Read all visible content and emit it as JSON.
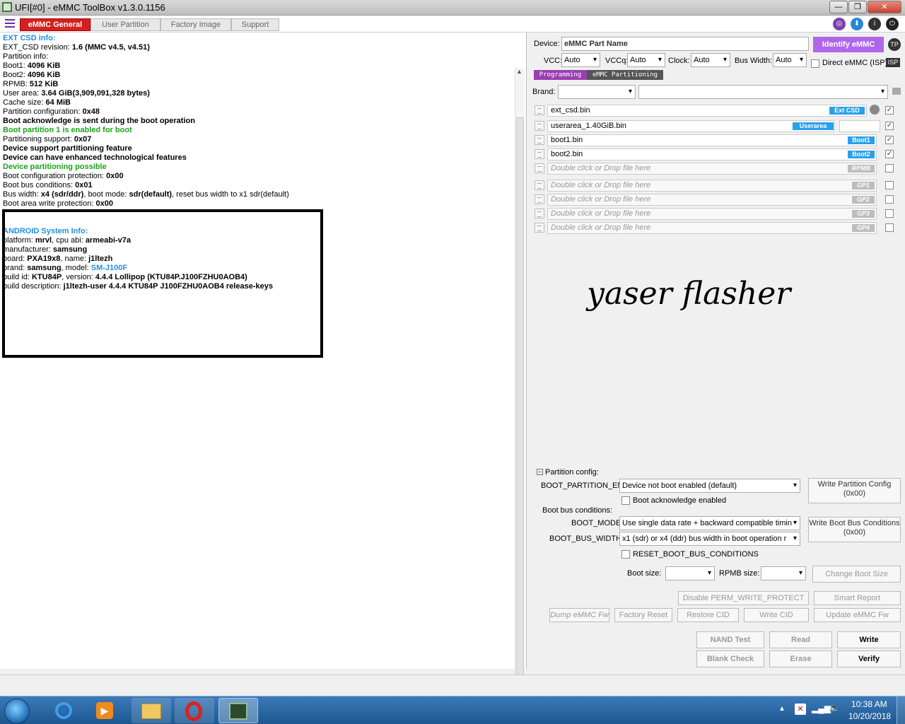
{
  "window": {
    "title": "UFI[#0] - eMMC ToolBox v1.3.0.1156"
  },
  "tabs": [
    "eMMC General",
    "User Partition",
    "Factory Image",
    "Support"
  ],
  "top_icons": [
    "purple-chip-icon",
    "download-icon",
    "info-icon",
    "power-icon"
  ],
  "log": [
    {
      "t": "EXT CSD info:",
      "c": "blue"
    },
    {
      "t": "EXT_CSD revision: ",
      "v": "1.6 (MMC v4.5, v4.51)"
    },
    {
      "t": "Partition info:"
    },
    {
      "t": " Boot1: ",
      "v": "4096 KiB"
    },
    {
      "t": " Boot2: ",
      "v": "4096 KiB"
    },
    {
      "t": " RPMB: ",
      "v": "512 KiB"
    },
    {
      "t": " User area: ",
      "v": "3.64 GiB(3,909,091,328 bytes)"
    },
    {
      "t": "Cache size: ",
      "v": "64 MiB"
    },
    {
      "t": "Partition configuration: ",
      "v": "0x48"
    },
    {
      "t": " Boot acknowledge is sent during the boot operation",
      "c": "b"
    },
    {
      "t": " Boot partition 1 is enabled for boot",
      "c": "green"
    },
    {
      "t": "Partitioning support: ",
      "v": "0x07"
    },
    {
      "t": " Device support partitioning feature",
      "c": "b"
    },
    {
      "t": " Device can have enhanced technological features",
      "c": "b"
    },
    {
      "t": " Device partitioning possible",
      "c": "green"
    },
    {
      "t": "Boot configuration protection: ",
      "v": "0x00"
    },
    {
      "t": "Boot bus conditions: ",
      "v": "0x01"
    },
    {
      "t": " Bus width: ",
      "v": "x4 (sdr/ddr)",
      "t2": ", boot mode: ",
      "v2": "sdr(default)",
      "t3": ", reset bus width to x1 sdr(default)"
    },
    {
      "t": "Boot area write protection: ",
      "v": "0x00"
    }
  ],
  "android": [
    {
      "t": "ANDROID System Info:",
      "c": "blue"
    },
    {
      "t": "platform: ",
      "v": "mrvl",
      "t2": ", cpu abi: ",
      "v2": "armeabi-v7a"
    },
    {
      "t": "manufacturer: ",
      "v": "samsung"
    },
    {
      "t": "board: ",
      "v": "PXA19x8",
      "t2": ", name: ",
      "v2": "j1ltezh"
    },
    {
      "t": "brand: ",
      "v": "samsung",
      "t2": ", model: ",
      "v3": "SM-J100F"
    },
    {
      "t": "build id: ",
      "v": "KTU84P",
      "t2": ", version: ",
      "v2": "4.4.4 Lollipop (KTU84P.J100FZHU0AOB4)"
    },
    {
      "t": "build description: ",
      "v": "j1ltezh-user 4.4.4 KTU84P J100FZHU0AOB4 release-keys"
    }
  ],
  "device": {
    "label": "Device:",
    "part_name": "eMMC Part Name",
    "identify_btn": "Identify eMMC",
    "tp": "TP",
    "vcc_label": "VCC:",
    "vcc": "Auto",
    "vccq_label": "VCCq:",
    "vccq": "Auto",
    "clock_label": "Clock:",
    "clock": "Auto",
    "bus_label": "Bus Width:",
    "bus": "Auto",
    "direct_label": "Direct eMMC (ISP)",
    "isp": "ISP"
  },
  "subtabs": [
    "Programming",
    "eMMC Partitioning"
  ],
  "brand_label": "Brand:",
  "files": [
    {
      "name": "ext_csd.bin",
      "tag": "Ext CSD",
      "checked": true,
      "empty": false
    },
    {
      "name": "userarea_1.40GiB.bin",
      "tag": "Userarea",
      "checked": true,
      "empty": false
    },
    {
      "name": "boot1.bin",
      "tag": "Boot1",
      "checked": true,
      "empty": false
    },
    {
      "name": "boot2.bin",
      "tag": "Boot2",
      "checked": true,
      "empty": false
    },
    {
      "name": "Double click or Drop file here",
      "tag": "RPMB",
      "checked": false,
      "empty": true
    },
    {
      "name": "Double click or Drop file here",
      "tag": "GP1",
      "checked": false,
      "empty": true
    },
    {
      "name": "Double click or Drop file here",
      "tag": "GP2",
      "checked": false,
      "empty": true
    },
    {
      "name": "Double click or Drop file here",
      "tag": "GP3",
      "checked": false,
      "empty": true
    },
    {
      "name": "Double click or Drop file here",
      "tag": "GP4",
      "checked": false,
      "empty": true
    }
  ],
  "watermark": "yaser flasher",
  "partcfg": {
    "title": "Partition config:",
    "boot_partition_label": "BOOT_PARTITION_EN",
    "boot_partition_value": "Device not boot enabled (default)",
    "write_partition_btn_line1": "Write Partition Config",
    "write_partition_btn_line2": "(0x00)",
    "boot_ack_label": "Boot acknowledge enabled",
    "boot_bus_title": "Boot bus conditions:",
    "boot_mode_label": "BOOT_MODE",
    "boot_mode_value": "Use single data rate + backward compatible timin",
    "boot_bus_width_label": "BOOT_BUS_WIDTH",
    "boot_bus_width_value": "x1 (sdr) or x4 (ddr) bus width in boot operation r",
    "write_bus_btn_line1": "Write Boot Bus Conditions",
    "write_bus_btn_line2": "(0x00)",
    "reset_label": "RESET_BOOT_BUS_CONDITIONS",
    "boot_size_label": "Boot size:",
    "rpmb_size_label": "RPMB size:",
    "change_boot_size": "Change Boot Size"
  },
  "actions": {
    "disable_perm": "Disable PERM_WRITE_PROTECT",
    "smart_report": "Smart Report",
    "dump_fw": "Dump eMMC Fw",
    "factory_reset": "Factory Reset",
    "restore_cid": "Restore CID",
    "write_cid": "Write CID",
    "update_fw": "Update eMMC Fw",
    "nand_test": "NAND Test",
    "read": "Read",
    "write": "Write",
    "blank_check": "Blank Check",
    "erase": "Erase",
    "verify": "Verify"
  },
  "taskbar": {
    "apps": [
      "ie-icon",
      "media-player-icon",
      "explorer-icon",
      "opera-icon",
      "ufi-toolbox-icon"
    ],
    "time": "10:38 AM",
    "date": "10/20/2018"
  }
}
